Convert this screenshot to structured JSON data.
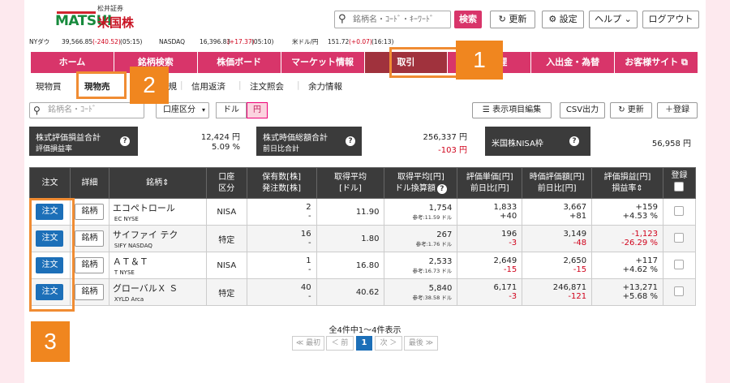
{
  "header": {
    "logo_kana": "松井証券",
    "logo_brand": "MATSUI",
    "logo_sub": "米国株",
    "search_placeholder": "銘柄名・ｺｰﾄﾞ・ｷｰﾜｰﾄﾞ",
    "search_btn": "検索",
    "refresh": "更新",
    "settings": "設定",
    "help": "ヘルプ",
    "logout": "ログアウト"
  },
  "ticker": [
    {
      "label": "NYダウ",
      "value": "39,566.85",
      "change": "(-240.52)",
      "time": "(05:15)"
    },
    {
      "label": "NASDAQ",
      "value": "16,396.83",
      "change": "(+17.37)",
      "time": "(05:10)"
    },
    {
      "label": "米ドル/円",
      "value": "151.72",
      "change": "(+0.07)",
      "time": "(16:13)"
    }
  ],
  "nav": [
    "ホーム",
    "銘柄検索",
    "株価ボード",
    "マーケット情報",
    "取引",
    "口座管理",
    "入出金・為替",
    "お客様サイト"
  ],
  "subnav": [
    "現物買",
    "現物売",
    "信用新規",
    "信用返済",
    "注文照会",
    "余力情報"
  ],
  "callouts": [
    "1",
    "2",
    "3"
  ],
  "toolbar": {
    "search_placeholder": "銘柄名・ｺｰﾄﾞ",
    "account_type": "口座区分",
    "dollar": "ドル",
    "yen": "円",
    "display_edit": "表示項目編集",
    "csv": "CSV出力",
    "refresh": "更新",
    "register": "登録"
  },
  "summary": {
    "box1_l1": "株式評価損益合計",
    "box1_l2": "評価損益率",
    "val1a": "12,424 円",
    "val1b": "5.09 %",
    "box2_l1": "株式時価総額合計",
    "box2_l2": "前日比合計",
    "val2a": "256,337 円",
    "val2b": "-103 円",
    "box3_l1": "米国株NISA枠",
    "val3": "56,958 円"
  },
  "table_headers": {
    "order": "注文",
    "detail": "詳細",
    "name": "銘柄",
    "account": "口座\n区分",
    "qty": "保有数[株]\n発注数[株]",
    "avg": "取得平均\n[ドル]",
    "avg_yen": "取得平均[円]\nドル換算額",
    "price": "評価単価[円]\n前日比[円]",
    "market": "時価評価額[円]\n前日比[円]",
    "pl": "評価損益[円]\n損益率",
    "reg": "登録"
  },
  "rows": [
    {
      "order": "注文",
      "detail": "銘柄",
      "name": "エコペトロール",
      "code": "EC",
      "market": "NYSE",
      "account": "NISA",
      "qty": "2",
      "ordered": "-",
      "avg": "11.90",
      "avg_yen": "1,754",
      "ref": "参考:11.59 ドル",
      "price": "1,833",
      "price_chg": "+40",
      "mv": "3,667",
      "mv_chg": "+81",
      "pl": "+159",
      "plr": "+4.53 %"
    },
    {
      "order": "注文",
      "detail": "銘柄",
      "name": "サイファイ テク",
      "code": "SIFY",
      "market": "NASDAQ",
      "account": "特定",
      "qty": "16",
      "ordered": "-",
      "avg": "1.80",
      "avg_yen": "267",
      "ref": "参考:1.76 ドル",
      "price": "196",
      "price_chg": "-3",
      "mv": "3,149",
      "mv_chg": "-48",
      "pl": "-1,123",
      "plr": "-26.29 %"
    },
    {
      "order": "注文",
      "detail": "銘柄",
      "name": "ＡＴ＆Ｔ",
      "code": "T",
      "market": "NYSE",
      "account": "NISA",
      "qty": "1",
      "ordered": "-",
      "avg": "16.80",
      "avg_yen": "2,533",
      "ref": "参考:16.73 ドル",
      "price": "2,649",
      "price_chg": "-15",
      "mv": "2,650",
      "mv_chg": "-15",
      "pl": "+117",
      "plr": "+4.62 %"
    },
    {
      "order": "注文",
      "detail": "銘柄",
      "name": "グローバルＸ Ｓ",
      "code": "XYLD",
      "market": "Arca",
      "account": "特定",
      "qty": "40",
      "ordered": "-",
      "avg": "40.62",
      "avg_yen": "5,840",
      "ref": "参考:38.58 ドル",
      "price": "6,171",
      "price_chg": "-3",
      "mv": "246,871",
      "mv_chg": "-121",
      "pl": "+13,271",
      "plr": "+5.68 %"
    }
  ],
  "pager": {
    "summary": "全4件中1～4件表示",
    "first": "≪ 最初",
    "prev": "＜ 前",
    "current": "1",
    "next": "次 ＞",
    "last": "最後 ≫"
  },
  "colors": {
    "pink": "#d8356a",
    "active": "#a0323d",
    "callout": "#f08c33",
    "order_blue": "#1c6fb8",
    "negative": "#d0021b"
  }
}
